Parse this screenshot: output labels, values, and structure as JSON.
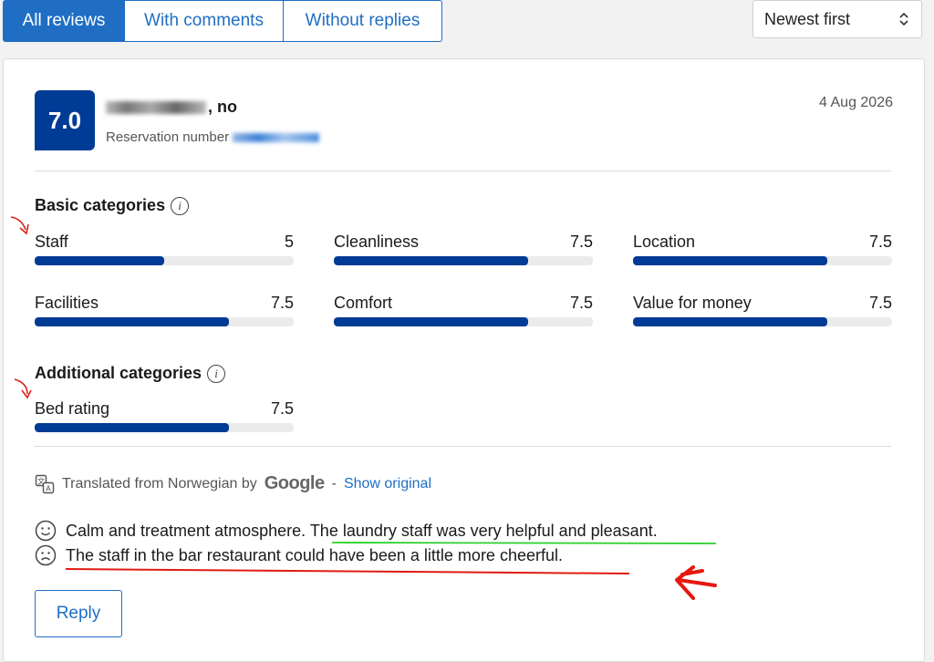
{
  "tabs": [
    {
      "label": "All reviews",
      "active": true
    },
    {
      "label": "With comments",
      "active": false
    },
    {
      "label": "Without replies",
      "active": false
    }
  ],
  "sort": {
    "selected": "Newest first"
  },
  "review": {
    "score": "7.0",
    "reviewer_suffix": ", no",
    "reservation_label": "Reservation number",
    "date": "4 Aug 2026"
  },
  "basic_categories": {
    "title": "Basic categories",
    "items": [
      {
        "label": "Staff",
        "value": "5",
        "fraction": 0.5
      },
      {
        "label": "Cleanliness",
        "value": "7.5",
        "fraction": 0.75
      },
      {
        "label": "Location",
        "value": "7.5",
        "fraction": 0.75
      },
      {
        "label": "Facilities",
        "value": "7.5",
        "fraction": 0.75
      },
      {
        "label": "Comfort",
        "value": "7.5",
        "fraction": 0.75
      },
      {
        "label": "Value for money",
        "value": "7.5",
        "fraction": 0.75
      }
    ]
  },
  "additional_categories": {
    "title": "Additional categories",
    "items": [
      {
        "label": "Bed rating",
        "value": "7.5",
        "fraction": 0.75
      }
    ]
  },
  "translation": {
    "prefix": "Translated from Norwegian by",
    "provider": "Google",
    "separator": "-",
    "show_original": "Show original"
  },
  "comments": {
    "positive_plain": "Calm and treatment atmosphere. ",
    "positive_highlight": "The laundry staff was very helpful and pleasant.",
    "negative": "The staff in the bar restaurant could have been a little more cheerful."
  },
  "reply_button": "Reply",
  "colors": {
    "accent": "#1f6ec4",
    "score_bg": "#003b95",
    "bar_fill": "#003b95",
    "bar_track": "#ebebeb"
  }
}
